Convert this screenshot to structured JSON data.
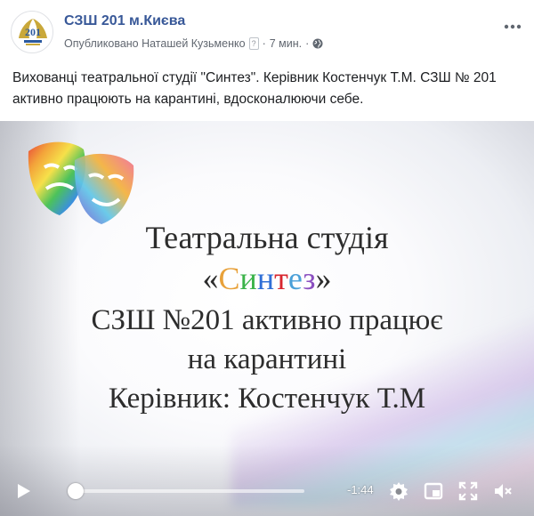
{
  "post": {
    "page_name": "СЗШ 201 м.Києва",
    "published_by": "Опубликовано Наташей Кузьменко",
    "help_marker": "?",
    "separator": "·",
    "time_ago": "7 мин.",
    "visibility_icon": "globe-icon",
    "more_icon": "more-dots-icon",
    "text": "Вихованці театральної студії \"Синтез\". Керівник Костенчук Т.М. СЗШ № 201 активно працюють на карантині, вдосконалюючи себе.",
    "avatar_text": "201"
  },
  "video": {
    "line1": "Театральна студія",
    "quote_open": "«",
    "quote_close": "»",
    "sintez_letters": [
      "С",
      "и",
      "н",
      "т",
      "е",
      "з"
    ],
    "sintez_colors": [
      "#e8a13a",
      "#3bb34a",
      "#2f6fd6",
      "#d8262e",
      "#4aa0d8",
      "#8b4fc0"
    ],
    "line3": "СЗШ №201 активно працює",
    "line4": "на карантині",
    "line5": "Керівник: Костенчук Т.М",
    "controls": {
      "time_remaining": "-1:44",
      "progress_fraction": 0.02,
      "icons": [
        "play-icon",
        "settings-icon",
        "picture-in-picture-icon",
        "fullscreen-icon",
        "volume-muted-icon"
      ]
    }
  },
  "colors": {
    "link": "#385898",
    "meta": "#616770",
    "text": "#1c1e21"
  }
}
